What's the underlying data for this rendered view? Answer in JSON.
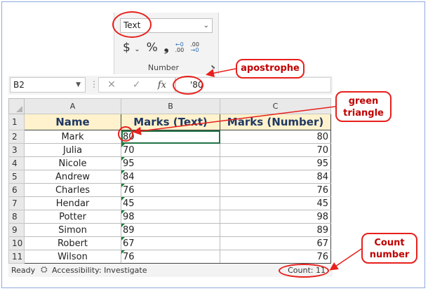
{
  "ribbon": {
    "number_format": "Text",
    "currency_symbol": "$",
    "percent_symbol": "%",
    "comma_symbol": "❟",
    "increase_decimal_top": "←0",
    "increase_decimal_bottom": ".00",
    "decrease_decimal_top": ".00",
    "decrease_decimal_bottom": "→0",
    "group_label": "Number"
  },
  "formula_bar": {
    "name_box": "B2",
    "cancel_symbol": "✕",
    "enter_symbol": "✓",
    "fx_label": "fx",
    "value": "'80"
  },
  "sheet": {
    "columns": [
      "A",
      "B",
      "C"
    ],
    "headers": [
      "Name",
      "Marks (Text)",
      "Marks (Number)"
    ],
    "rows": [
      {
        "row": "2",
        "name": "Mark",
        "text": "80",
        "number": "80"
      },
      {
        "row": "3",
        "name": "Julia",
        "text": "70",
        "number": "70"
      },
      {
        "row": "4",
        "name": "Nicole",
        "text": "95",
        "number": "95"
      },
      {
        "row": "5",
        "name": "Andrew",
        "text": "84",
        "number": "84"
      },
      {
        "row": "6",
        "name": "Charles",
        "text": "76",
        "number": "76"
      },
      {
        "row": "7",
        "name": "Hendar",
        "text": "45",
        "number": "45"
      },
      {
        "row": "8",
        "name": "Potter",
        "text": "98",
        "number": "98"
      },
      {
        "row": "9",
        "name": "Simon",
        "text": "89",
        "number": "89"
      },
      {
        "row": "10",
        "name": "Robert",
        "text": "67",
        "number": "67"
      },
      {
        "row": "11",
        "name": "Wilson",
        "text": "76",
        "number": "76"
      }
    ],
    "header_row": "1"
  },
  "status_bar": {
    "ready": "Ready",
    "accessibility": "Accessibility: Investigate",
    "count": "Count: 11"
  },
  "annotations": {
    "apostrophe": "apostrophe",
    "green_triangle": "green triangle",
    "count_number": "Count number"
  },
  "colors": {
    "annotation": "#e8201c",
    "header_fill": "#fff2cc",
    "header_text": "#1f3864",
    "error_triangle": "#1e7b34"
  }
}
